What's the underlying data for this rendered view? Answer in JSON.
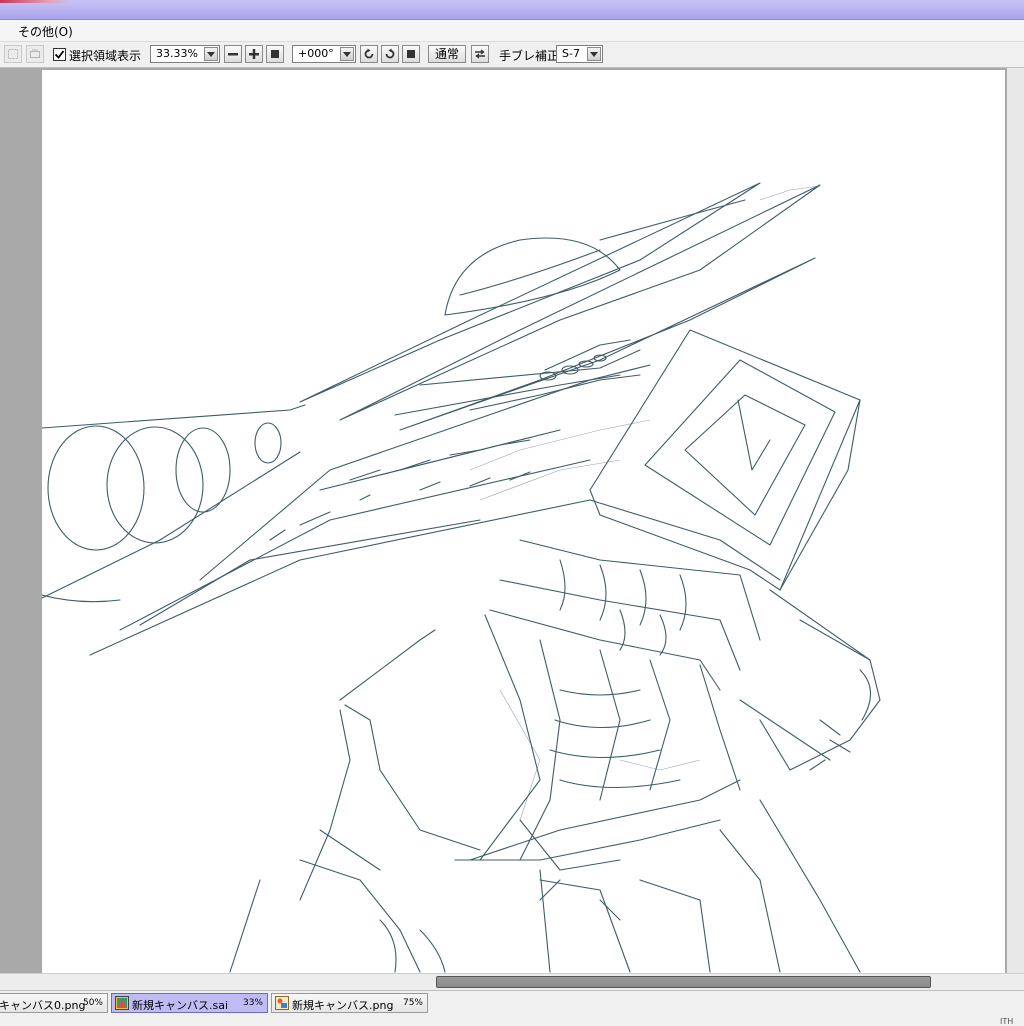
{
  "menubar": {
    "items": [
      {
        "label": "その他(O)"
      }
    ]
  },
  "toolbar": {
    "selection_display": {
      "label": "選択領域表示",
      "checked": true
    },
    "zoom": {
      "value": "33.33%"
    },
    "rotation": {
      "value": "+000°"
    },
    "blend_mode": {
      "label": "通常"
    },
    "stabilizer": {
      "label": "手ブレ補正",
      "value": "S-7"
    }
  },
  "tabs": [
    {
      "name": "キャンバス0.png",
      "zoom": "50%",
      "active": false,
      "icon": "png-file-icon"
    },
    {
      "name": "新規キャンバス.sai",
      "zoom": "33%",
      "active": true,
      "icon": "sai-file-icon"
    },
    {
      "name": "新規キャンバス.png",
      "zoom": "75%",
      "active": false,
      "icon": "png-file-icon"
    }
  ],
  "colors": {
    "titlebar": "#aaa3ec",
    "active_tab": "#bfbcf4",
    "sketch_line": "#3f5c66",
    "workspace_bg": "#a9a9a9"
  },
  "corner_text": "ITH"
}
